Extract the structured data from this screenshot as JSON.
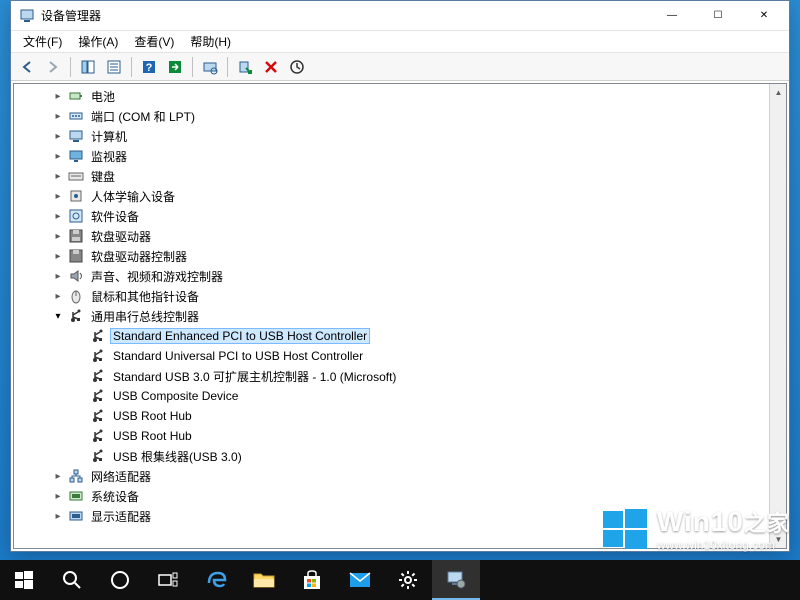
{
  "window": {
    "title": "设备管理器",
    "menu": {
      "file": "文件(F)",
      "action": "操作(A)",
      "view": "查看(V)",
      "help": "帮助(H)"
    },
    "controls": {
      "min": "—",
      "max": "☐",
      "close": "✕"
    }
  },
  "toolbar": {
    "back": "←",
    "forward": "→",
    "up": "",
    "props": "",
    "help": "?",
    "refresh": "",
    "scan": "",
    "remove": "✖",
    "update": ""
  },
  "tree": {
    "nodes": [
      {
        "label": "电池",
        "icon": "battery-icon",
        "depth": 1,
        "expander": "▸"
      },
      {
        "label": "端口 (COM 和 LPT)",
        "icon": "port-icon",
        "depth": 1,
        "expander": "▸"
      },
      {
        "label": "计算机",
        "icon": "computer-icon",
        "depth": 1,
        "expander": "▸"
      },
      {
        "label": "监视器",
        "icon": "monitor-icon",
        "depth": 1,
        "expander": "▸"
      },
      {
        "label": "键盘",
        "icon": "keyboard-icon",
        "depth": 1,
        "expander": "▸"
      },
      {
        "label": "人体学输入设备",
        "icon": "hid-icon",
        "depth": 1,
        "expander": "▸"
      },
      {
        "label": "软件设备",
        "icon": "software-device-icon",
        "depth": 1,
        "expander": "▸"
      },
      {
        "label": "软盘驱动器",
        "icon": "floppy-icon",
        "depth": 1,
        "expander": "▸"
      },
      {
        "label": "软盘驱动器控制器",
        "icon": "floppy-controller-icon",
        "depth": 1,
        "expander": "▸"
      },
      {
        "label": "声音、视频和游戏控制器",
        "icon": "sound-icon",
        "depth": 1,
        "expander": "▸"
      },
      {
        "label": "鼠标和其他指针设备",
        "icon": "mouse-icon",
        "depth": 1,
        "expander": "▸"
      },
      {
        "label": "通用串行总线控制器",
        "icon": "usb-controller-icon",
        "depth": 1,
        "expander": "▾",
        "open": true
      },
      {
        "label": "Standard Enhanced PCI to USB Host Controller",
        "icon": "usb-icon",
        "depth": 2,
        "expander": "",
        "selected": true
      },
      {
        "label": "Standard Universal PCI to USB Host Controller",
        "icon": "usb-icon",
        "depth": 2,
        "expander": ""
      },
      {
        "label": "Standard USB 3.0 可扩展主机控制器 - 1.0 (Microsoft)",
        "icon": "usb-icon",
        "depth": 2,
        "expander": ""
      },
      {
        "label": "USB Composite Device",
        "icon": "usb-icon",
        "depth": 2,
        "expander": ""
      },
      {
        "label": "USB Root Hub",
        "icon": "usb-icon",
        "depth": 2,
        "expander": ""
      },
      {
        "label": "USB Root Hub",
        "icon": "usb-icon",
        "depth": 2,
        "expander": ""
      },
      {
        "label": "USB 根集线器(USB 3.0)",
        "icon": "usb-icon",
        "depth": 2,
        "expander": ""
      },
      {
        "label": "网络适配器",
        "icon": "network-icon",
        "depth": 1,
        "expander": "▸"
      },
      {
        "label": "系统设备",
        "icon": "system-device-icon",
        "depth": 1,
        "expander": "▸"
      },
      {
        "label": "显示适配器",
        "icon": "display-adapter-icon",
        "depth": 1,
        "expander": "▸"
      }
    ]
  },
  "watermark": {
    "brand": "Win10",
    "suffix": "之家",
    "url": "www.win10xitong.com"
  },
  "taskbar": {
    "items": [
      "start",
      "search",
      "cortana",
      "taskview",
      "edge",
      "explorer",
      "store",
      "mail",
      "settings",
      "devmgr"
    ]
  }
}
